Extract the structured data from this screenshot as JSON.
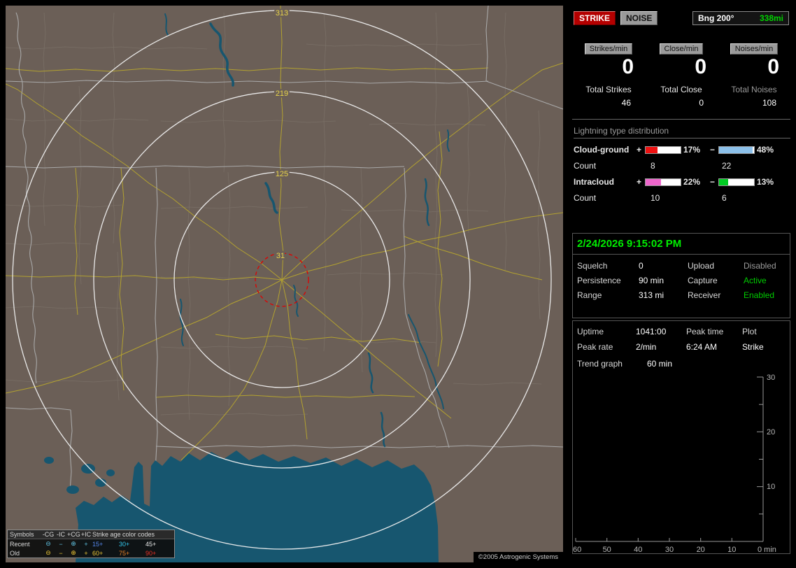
{
  "colors": {
    "strike_button_bg": "#b40000",
    "noise_button_bg": "#9a9a9a",
    "bearing_distance_green": "#00d400",
    "datetime_green": "#00ee00",
    "active_green": "#00cc00",
    "disabled_gray": "#9a9a9a",
    "bar_pos_cloud_ground": "#ee1111",
    "bar_neg_cloud_ground": "#8cc0ea",
    "bar_pos_intracloud": "#ee66cc",
    "bar_neg_intracloud": "#00cc22",
    "map_land": "#6b5f57",
    "map_water": "#17566f",
    "map_road": "#b3a230",
    "range_ring": "#f0f0f0",
    "range_label": "#e8d44a",
    "alert_circle": "#e00000"
  },
  "map": {
    "range_labels": [
      "313",
      "219",
      "125",
      "31"
    ],
    "copyright": "©2005 Astrogenic Systems",
    "legend": {
      "symbols_header": "Symbols",
      "col_headers": [
        "-CG",
        "-IC",
        "+CG",
        "+IC"
      ],
      "age_header": "Strike age color codes",
      "recent_label": "Recent",
      "old_label": "Old",
      "recent_symbols": [
        "⊖",
        "−",
        "⊕",
        "+"
      ],
      "old_symbols": [
        "⊖",
        "−",
        "⊕",
        "+"
      ],
      "recent_ages": [
        "15+",
        "30+",
        "45+"
      ],
      "old_ages": [
        "60+",
        "75+",
        "90+"
      ]
    }
  },
  "panel": {
    "strike_button": "STRIKE",
    "noise_button": "NOISE",
    "bearing_label": "Bng 200°",
    "bearing_distance": "338mi",
    "counters": [
      {
        "label": "Strikes/min",
        "value": "0",
        "total_label": "Total Strikes",
        "total_value": "46"
      },
      {
        "label": "Close/min",
        "value": "0",
        "total_label": "Total Close",
        "total_value": "0"
      },
      {
        "label": "Noises/min",
        "value": "0",
        "total_label": "Total Noises",
        "total_value": "108"
      }
    ],
    "distribution": {
      "title": "Lightning type distribution",
      "rows": [
        {
          "label": "Cloud-ground",
          "plus": "+",
          "pos_pct": "17%",
          "minus": "−",
          "neg_pct": "48%",
          "count_label": "Count",
          "pos_count": "8",
          "neg_count": "22"
        },
        {
          "label": "Intracloud",
          "plus": "+",
          "pos_pct": "22%",
          "minus": "−",
          "neg_pct": "13%",
          "count_label": "Count",
          "pos_count": "10",
          "neg_count": "6"
        }
      ]
    },
    "status": {
      "datetime": "2/24/2026 9:15:02 PM",
      "rows": [
        {
          "k1": "Squelch",
          "v1": "0",
          "k2": "Upload",
          "v2": "Disabled"
        },
        {
          "k1": "Persistence",
          "v1": "90 min",
          "k2": "Capture",
          "v2": "Active"
        },
        {
          "k1": "Range",
          "v1": "313 mi",
          "k2": "Receiver",
          "v2": "Enabled"
        }
      ]
    },
    "stats": {
      "uptime_label": "Uptime",
      "uptime_value": "1041:00",
      "peak_time_label": "Peak time",
      "peak_time_value": "6:24 AM",
      "plot_label": "Plot",
      "plot_value": "Strike",
      "peak_rate_label": "Peak rate",
      "peak_rate_value": "2/min",
      "trend_label": "Trend graph",
      "trend_value": "60 min"
    },
    "trend_chart": {
      "y_ticks": [
        "30",
        "20",
        "10"
      ],
      "x_ticks": [
        "60",
        "50",
        "40",
        "30",
        "20",
        "10"
      ],
      "x_end_label": "0 min"
    }
  }
}
